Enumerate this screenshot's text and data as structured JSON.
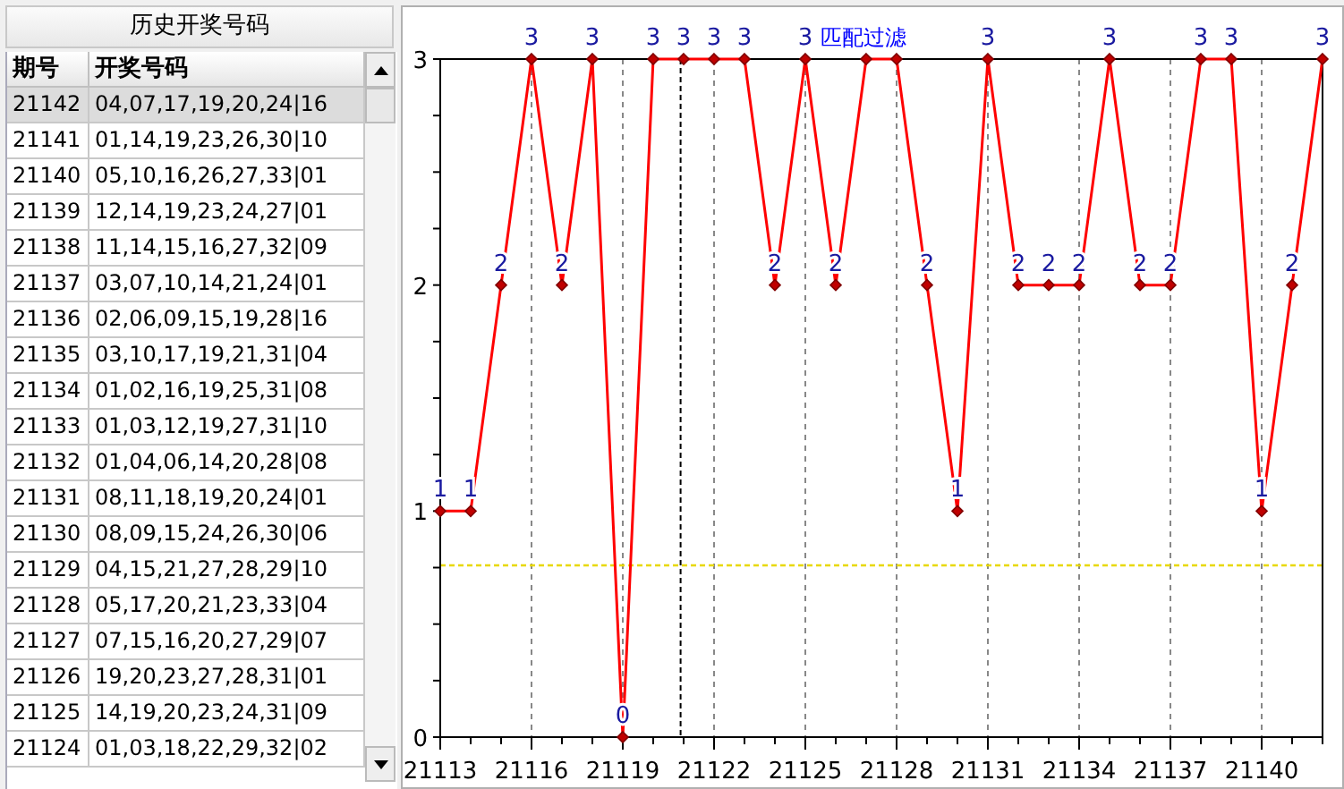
{
  "history_panel": {
    "title": "历史开奖号码",
    "columns": [
      "期号",
      "开奖号码"
    ],
    "rows": [
      {
        "issue": "21142",
        "numbers": "04,07,17,19,20,24|16",
        "selected": true
      },
      {
        "issue": "21141",
        "numbers": "01,14,19,23,26,30|10",
        "selected": false
      },
      {
        "issue": "21140",
        "numbers": "05,10,16,26,27,33|01",
        "selected": false
      },
      {
        "issue": "21139",
        "numbers": "12,14,19,23,24,27|01",
        "selected": false
      },
      {
        "issue": "21138",
        "numbers": "11,14,15,16,27,32|09",
        "selected": false
      },
      {
        "issue": "21137",
        "numbers": "03,07,10,14,21,24|01",
        "selected": false
      },
      {
        "issue": "21136",
        "numbers": "02,06,09,15,19,28|16",
        "selected": false
      },
      {
        "issue": "21135",
        "numbers": "03,10,17,19,21,31|04",
        "selected": false
      },
      {
        "issue": "21134",
        "numbers": "01,02,16,19,25,31|08",
        "selected": false
      },
      {
        "issue": "21133",
        "numbers": "01,03,12,19,27,31|10",
        "selected": false
      },
      {
        "issue": "21132",
        "numbers": "01,04,06,14,20,28|08",
        "selected": false
      },
      {
        "issue": "21131",
        "numbers": "08,11,18,19,20,24|01",
        "selected": false
      },
      {
        "issue": "21130",
        "numbers": "08,09,15,24,26,30|06",
        "selected": false
      },
      {
        "issue": "21129",
        "numbers": "04,15,21,27,28,29|10",
        "selected": false
      },
      {
        "issue": "21128",
        "numbers": "05,17,20,21,23,33|04",
        "selected": false
      },
      {
        "issue": "21127",
        "numbers": "07,15,16,20,27,29|07",
        "selected": false
      },
      {
        "issue": "21126",
        "numbers": "19,20,23,27,28,31|01",
        "selected": false
      },
      {
        "issue": "21125",
        "numbers": "14,19,20,23,24,31|09",
        "selected": false
      },
      {
        "issue": "21124",
        "numbers": "01,03,18,22,29,32|02",
        "selected": false
      }
    ]
  },
  "chart": {
    "chart_data": {
      "type": "line",
      "x": [
        21113,
        21114,
        21115,
        21116,
        21117,
        21118,
        21119,
        21120,
        21121,
        21122,
        21123,
        21124,
        21125,
        21126,
        21127,
        21128,
        21129,
        21130,
        21131,
        21132,
        21133,
        21134,
        21135,
        21136,
        21137,
        21138,
        21139,
        21140,
        21141,
        21142
      ],
      "series": [
        {
          "color": "#ff0000",
          "marker": "diamond",
          "values": [
            1,
            1,
            2,
            3,
            2,
            3,
            0,
            3,
            3,
            3,
            3,
            2,
            3,
            2,
            3,
            3,
            2,
            1,
            3,
            2,
            2,
            2,
            3,
            2,
            2,
            3,
            3,
            1,
            2,
            3
          ]
        }
      ],
      "xlim": [
        21113,
        21142
      ],
      "ylim": [
        0,
        3
      ],
      "xticks": [
        21113,
        21116,
        21119,
        21122,
        21125,
        21128,
        21131,
        21134,
        21137,
        21140
      ],
      "yticks": [
        0,
        1,
        2,
        3
      ],
      "grid": "x",
      "value_labels": [
        "1",
        "1",
        "2",
        "3",
        "2",
        "3",
        "0",
        "3",
        "3",
        "3",
        "3",
        "2",
        "3",
        "2",
        null,
        null,
        "2",
        "1",
        "3",
        "2",
        "2",
        "2",
        "3",
        "2",
        "2",
        "3",
        "3",
        "1",
        "2",
        "3"
      ],
      "ref_lines": [
        {
          "axis": "y",
          "value": 0.76,
          "color": "#e8d800"
        },
        {
          "axis": "x",
          "value": 21120.9,
          "color": "#000000"
        }
      ],
      "annotations": [
        {
          "x": 21126.9,
          "y": 3,
          "text": "匹配过滤"
        }
      ]
    }
  }
}
